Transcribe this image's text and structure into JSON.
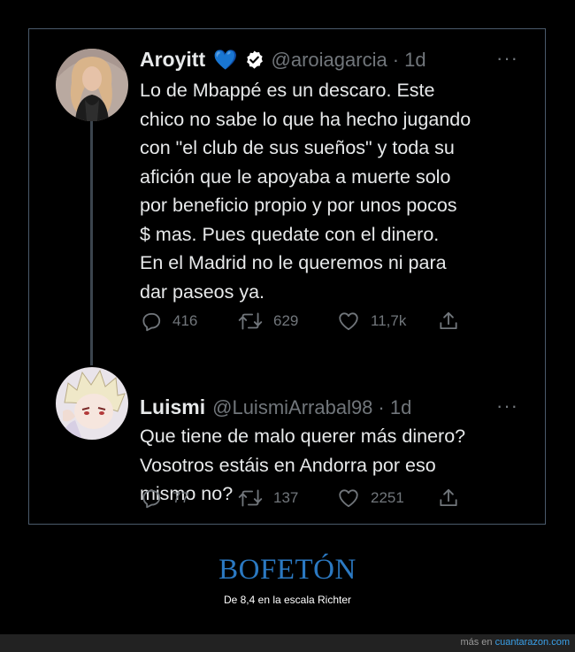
{
  "tweets": [
    {
      "display_name": "Aroyitt",
      "emoji": "💙",
      "handle": "@aroiagarcia",
      "time": "· 1d",
      "more": "···",
      "body_lines": [
        "Lo de Mbappé es un descaro. Este",
        "chico no sabe lo que ha hecho jugando",
        "con \"el club de sus sueños\" y toda su",
        "afición que le apoyaba a muerte solo",
        "por beneficio propio y por unos pocos",
        "$ mas. Pues quedate con el dinero.",
        "En el Madrid no le queremos ni para",
        "dar paseos ya."
      ],
      "replies": "416",
      "retweets": "629",
      "likes": "11,7k"
    },
    {
      "display_name": "Luismi",
      "handle": "@LuismiArrabal98",
      "time": "· 1d",
      "more": "···",
      "body_lines": [
        "Que tiene de malo querer más dinero?",
        "Vosotros estáis en Andorra por eso",
        "mismo no?"
      ],
      "replies": "77",
      "retweets": "137",
      "likes": "2251"
    }
  ],
  "caption": {
    "title": "BOFETÓN",
    "subtitle": "De 8,4 en la escala Richter"
  },
  "footer": {
    "prefix": "más en",
    "link": "cuantarazon.com"
  },
  "icons": [
    "reply-icon",
    "retweet-icon",
    "like-icon",
    "share-icon",
    "verified-badge-icon"
  ],
  "colors": {
    "accent": "#2b79c2",
    "text": "#e7e9ea",
    "muted": "#71767b",
    "border": "#4a5a6b",
    "verified_badge": "#ffffff"
  }
}
